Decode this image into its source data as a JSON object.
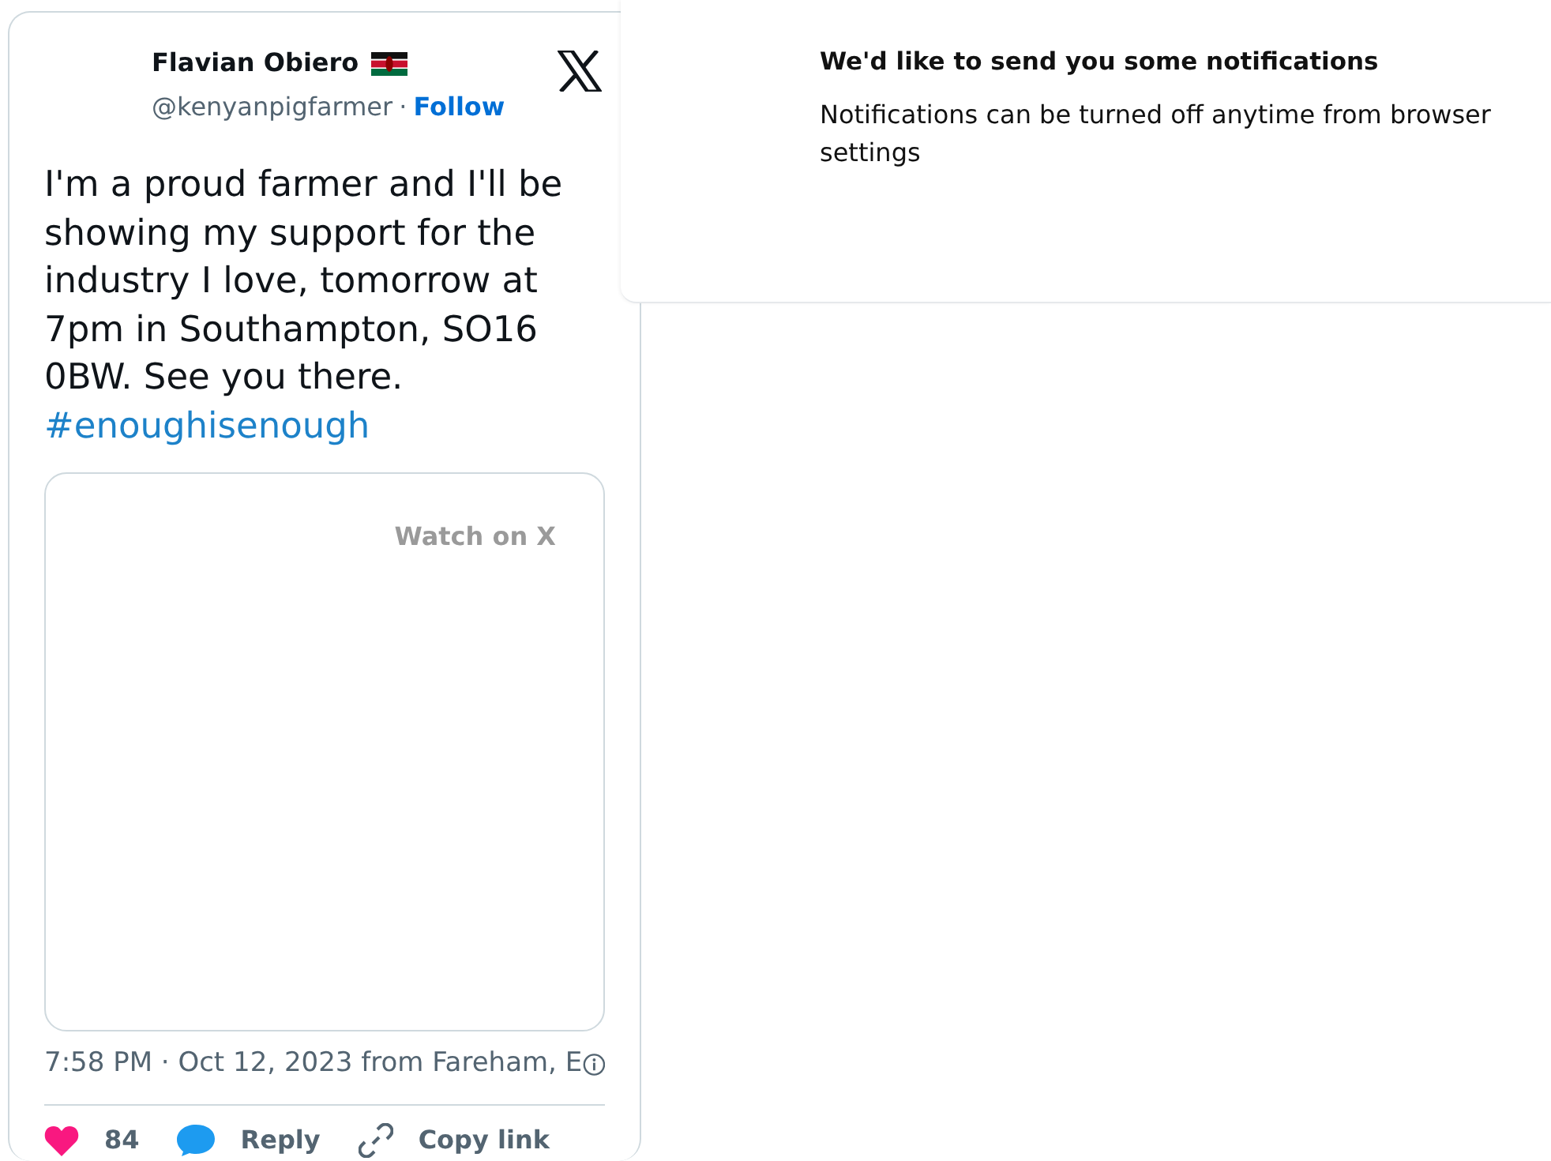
{
  "tweet": {
    "author": {
      "name": "Flavian Obiero",
      "handle": "@kenyanpigfarmer",
      "separator": "·",
      "follow": "Follow"
    },
    "text": "I'm a proud farmer and I'll be showing my support for the industry I love, tomorrow at 7pm in Southampton, SO16 0BW. See you there.",
    "hashtag": "#enoughisenough",
    "media": {
      "watch_label": "Watch on X"
    },
    "timestamp": "7:58 PM · Oct 12, 2023 from Fareham, E",
    "actions": [
      {
        "kind": "like",
        "label": "84"
      },
      {
        "kind": "reply",
        "label": "Reply"
      },
      {
        "kind": "copy",
        "label": "Copy link"
      }
    ]
  },
  "notification": {
    "title": "We'd like to send you some notifications",
    "body": "Notifications can be turned off anytime from browser settings"
  }
}
